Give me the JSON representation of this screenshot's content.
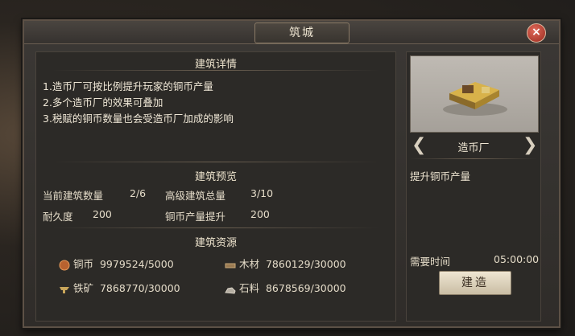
{
  "window": {
    "title": "筑城",
    "close_label": "×"
  },
  "details": {
    "heading": "建筑详情",
    "lines": [
      "1.造币厂可按比例提升玩家的铜币产量",
      "2.多个造币厂的效果可叠加",
      "3.税赋的铜币数量也会受造币厂加成的影响"
    ]
  },
  "preview": {
    "heading": "建筑预览",
    "current_count_label": "当前建筑数量",
    "current_count_value": "2/6",
    "advanced_total_label": "高级建筑总量",
    "advanced_total_value": "3/10",
    "durability_label": "耐久度",
    "durability_value": "200",
    "copper_boost_label": "铜币产量提升",
    "copper_boost_value": "200"
  },
  "resources": {
    "heading": "建筑资源",
    "copper": {
      "label": "铜币",
      "value": "9979524/5000",
      "icon": "copper-coin-icon"
    },
    "wood": {
      "label": "木材",
      "value": "7860129/30000",
      "icon": "wood-icon"
    },
    "iron": {
      "label": "铁矿",
      "value": "7868770/30000",
      "icon": "iron-anvil-icon"
    },
    "stone": {
      "label": "石料",
      "value": "8678569/30000",
      "icon": "stone-icon"
    }
  },
  "building": {
    "name": "造币厂",
    "description": "提升铜币产量",
    "time_label": "需要时间",
    "time_value": "05:00:00",
    "build_label": "建造"
  },
  "colors": {
    "panel": "#36322f",
    "accent": "#8a7a66",
    "close": "#c0392b"
  }
}
